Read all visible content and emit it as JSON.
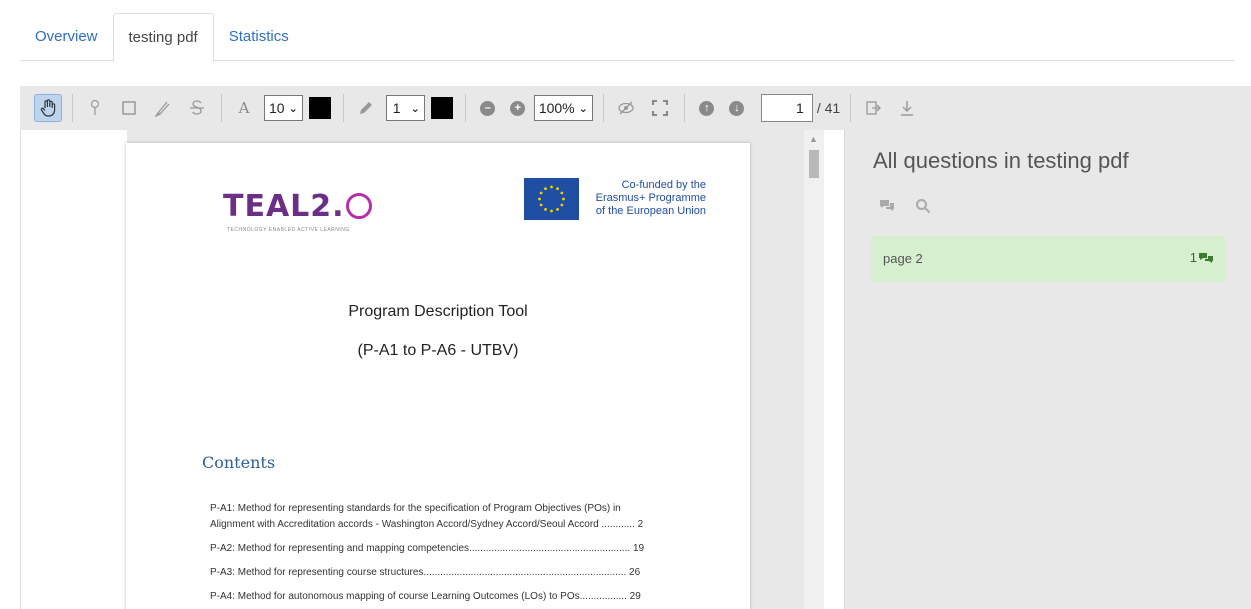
{
  "tabs": [
    {
      "label": "Overview",
      "active": false
    },
    {
      "label": "testing pdf",
      "active": true
    },
    {
      "label": "Statistics",
      "active": false
    }
  ],
  "toolbar": {
    "font_size": "10",
    "line_width": "1",
    "zoom": "100%",
    "current_page": "1",
    "total_pages": "/ 41",
    "font_label": "A",
    "pen_color": "#000000",
    "text_color": "#000000"
  },
  "document": {
    "logo_text": "TEAL2.",
    "logo_sub": "TECHNOLOGY ENABLED ACTIVE LEARNING",
    "eu_line1": "Co-funded by the",
    "eu_line2": "Erasmus+ Programme",
    "eu_line3": "of the European Union",
    "title": "Program Description Tool",
    "subtitle": "(P-A1 to P-A6 - UTBV)",
    "contents_heading": "Contents",
    "toc": [
      "P-A1: Method for representing standards for the specification of Program Objectives (POs) in",
      "Alignment with Accreditation accords - Washington Accord/Sydney Accord/Seoul Accord ............ 2",
      "P-A2: Method for representing and mapping competencies.......................................................... 19",
      "P-A3: Method for representing course structures......................................................................... 26",
      "P-A4: Method for autonomous mapping of course Learning Outcomes (LOs) to POs................. 29"
    ]
  },
  "panel": {
    "title": "All questions in testing pdf",
    "questions": [
      {
        "label": "page 2",
        "count": "1"
      }
    ],
    "item_bg": "#d6efcf"
  }
}
